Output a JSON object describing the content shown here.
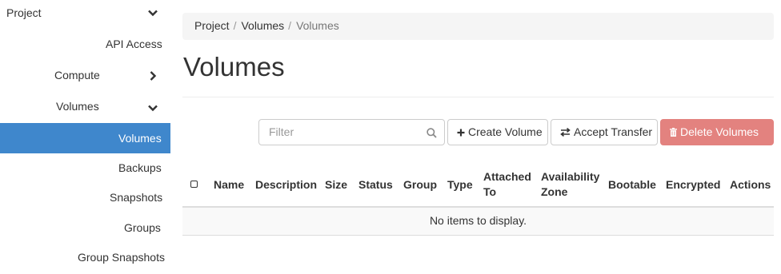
{
  "sidebar": {
    "items": [
      {
        "label": "Project",
        "icon": "chevron-down-icon"
      },
      {
        "label": "API Access"
      },
      {
        "label": "Compute",
        "icon": "chevron-right-icon"
      },
      {
        "label": "Volumes",
        "icon": "chevron-down-icon"
      },
      {
        "label": "Volumes",
        "active": true
      },
      {
        "label": "Backups"
      },
      {
        "label": "Snapshots"
      },
      {
        "label": "Groups"
      },
      {
        "label": "Group Snapshots"
      }
    ]
  },
  "breadcrumb": [
    "Project",
    "Volumes",
    "Volumes"
  ],
  "breadcrumb_separator": "/",
  "page_title": "Volumes",
  "filter": {
    "placeholder": "Filter",
    "value": ""
  },
  "actions": {
    "create_volume": "Create Volume",
    "accept_transfer": "Accept Transfer",
    "delete_volumes": "Delete Volumes"
  },
  "table": {
    "columns": [
      "Name",
      "Description",
      "Size",
      "Status",
      "Group",
      "Type",
      "Attached To",
      "Availability Zone",
      "Bootable",
      "Encrypted",
      "Actions"
    ],
    "column_lines": {
      "attached_to": [
        "Attached",
        "To"
      ],
      "availability_zone": [
        "Availability",
        "Zone"
      ]
    },
    "empty_message": "No items to display."
  },
  "colors": {
    "active_sidebar": "#3f87cc",
    "delete_button": "#e27c79",
    "breadcrumb_bg": "#f5f5f5"
  }
}
